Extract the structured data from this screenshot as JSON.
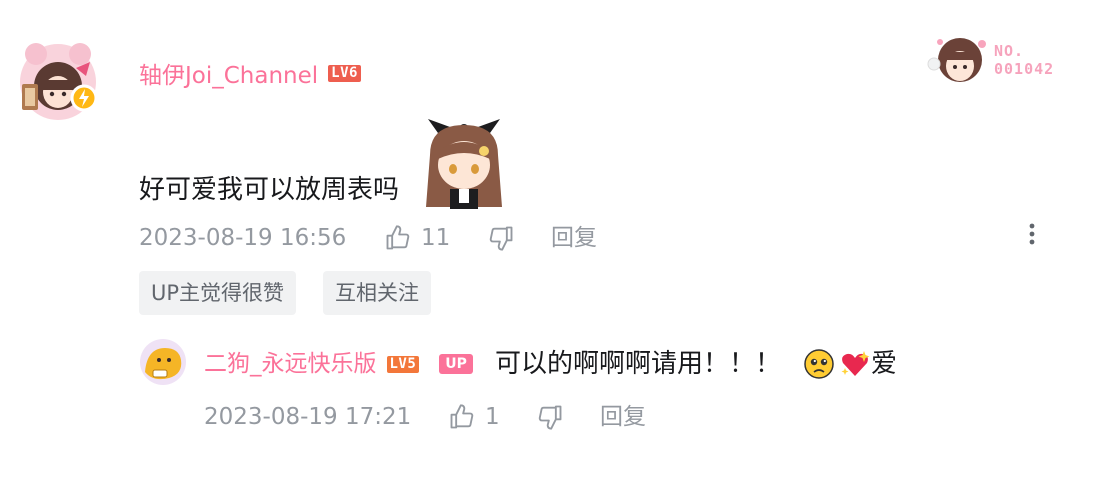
{
  "colors": {
    "username": "#fb7299",
    "meta_text": "#9499a0",
    "tag_bg": "#f1f2f3",
    "lv5": "#f3773a",
    "lv6": "#ee5e4f"
  },
  "comment": {
    "username": "轴伊Joi_Channel",
    "level_badge": "LV6",
    "fan_badge_number": "NO.\n001042",
    "content": "好可爱我可以放周表吗",
    "time": "2023-08-19 16:56",
    "like_count": "11",
    "reply_label": "回复",
    "icons": {
      "avatar": "avatar-icon",
      "like": "thumb-up-icon",
      "dislike": "thumb-down-icon",
      "more": "more-vertical-icon",
      "sticker": "chibi-girl-sticker"
    },
    "tags": [
      "UP主觉得很赞",
      "互相关注"
    ]
  },
  "reply": {
    "username": "二狗_永远快乐版",
    "level_badge": "LV5",
    "up_badge": "UP",
    "content": "可以的啊啊啊请用！！！",
    "content_tail": "爱",
    "time": "2023-08-19 17:21",
    "like_count": "1",
    "reply_label": "回复",
    "emojis": [
      "pleading-face-emoji",
      "sparkling-heart-emoji"
    ]
  }
}
